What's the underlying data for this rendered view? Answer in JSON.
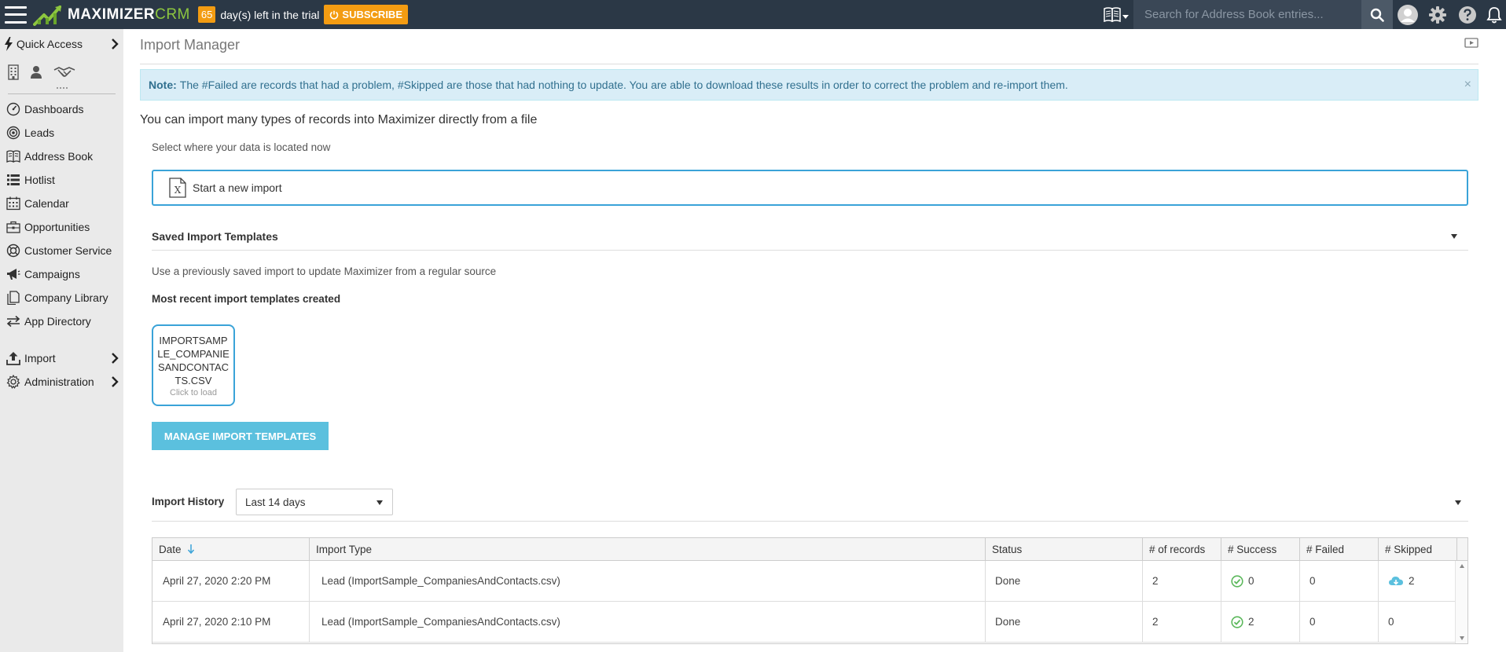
{
  "topbar": {
    "logo_brand": "MAXIMIZER",
    "logo_suffix": "CRM",
    "trial_days": "65",
    "trial_text": "day(s) left in the trial",
    "subscribe_label": "SUBSCRIBE",
    "search_placeholder": "Search for Address Book entries..."
  },
  "sidebar": {
    "quick_access": "Quick Access",
    "items": [
      {
        "label": "Dashboards"
      },
      {
        "label": "Leads"
      },
      {
        "label": "Address Book"
      },
      {
        "label": "Hotlist"
      },
      {
        "label": "Calendar"
      },
      {
        "label": "Opportunities"
      },
      {
        "label": "Customer Service"
      },
      {
        "label": "Campaigns"
      },
      {
        "label": "Company Library"
      },
      {
        "label": "App Directory"
      }
    ],
    "bottom_items": [
      {
        "label": "Import"
      },
      {
        "label": "Administration"
      }
    ]
  },
  "main": {
    "title": "Import Manager",
    "note_label": "Note:",
    "note_text": "The #Failed are records that had a problem, #Skipped are those that had nothing to update. You are able to download these results in order to correct the problem and re-import them.",
    "note_close": "×",
    "intro": "You can import many types of records into Maximizer directly from a file",
    "select_where": "Select where your data is located now",
    "start_import": "Start a new import",
    "saved_templates_title": "Saved Import Templates",
    "use_previous": "Use a previously saved import to update Maximizer from a regular source",
    "most_recent": "Most recent import templates created",
    "template": {
      "name": "IMPORTSAMPLE_COMPANIESANDCONTACTS.CSV",
      "sub": "Click to load"
    },
    "manage_button": "MANAGE IMPORT TEMPLATES",
    "history_label": "Import History",
    "history_filter": "Last 14 days"
  },
  "table": {
    "columns": [
      "Date",
      "Import Type",
      "Status",
      "# of records",
      "# Success",
      "# Failed",
      "# Skipped"
    ],
    "rows": [
      {
        "date": "April 27, 2020 2:20 PM",
        "type": "Lead (ImportSample_CompaniesAndContacts.csv)",
        "status": "Done",
        "records": "2",
        "success": "0",
        "failed": "0",
        "skipped": "2"
      },
      {
        "date": "April 27, 2020 2:10 PM",
        "type": "Lead (ImportSample_CompaniesAndContacts.csv)",
        "status": "Done",
        "records": "2",
        "success": "2",
        "failed": "0",
        "skipped": "0"
      }
    ]
  },
  "colors": {
    "topbar": "#2b3846",
    "accent_orange": "#f39c12",
    "brand_green": "#8dc63f",
    "link_blue": "#3aa3d8",
    "note_bg": "#d9edf7",
    "success_green": "#5cb85c"
  }
}
